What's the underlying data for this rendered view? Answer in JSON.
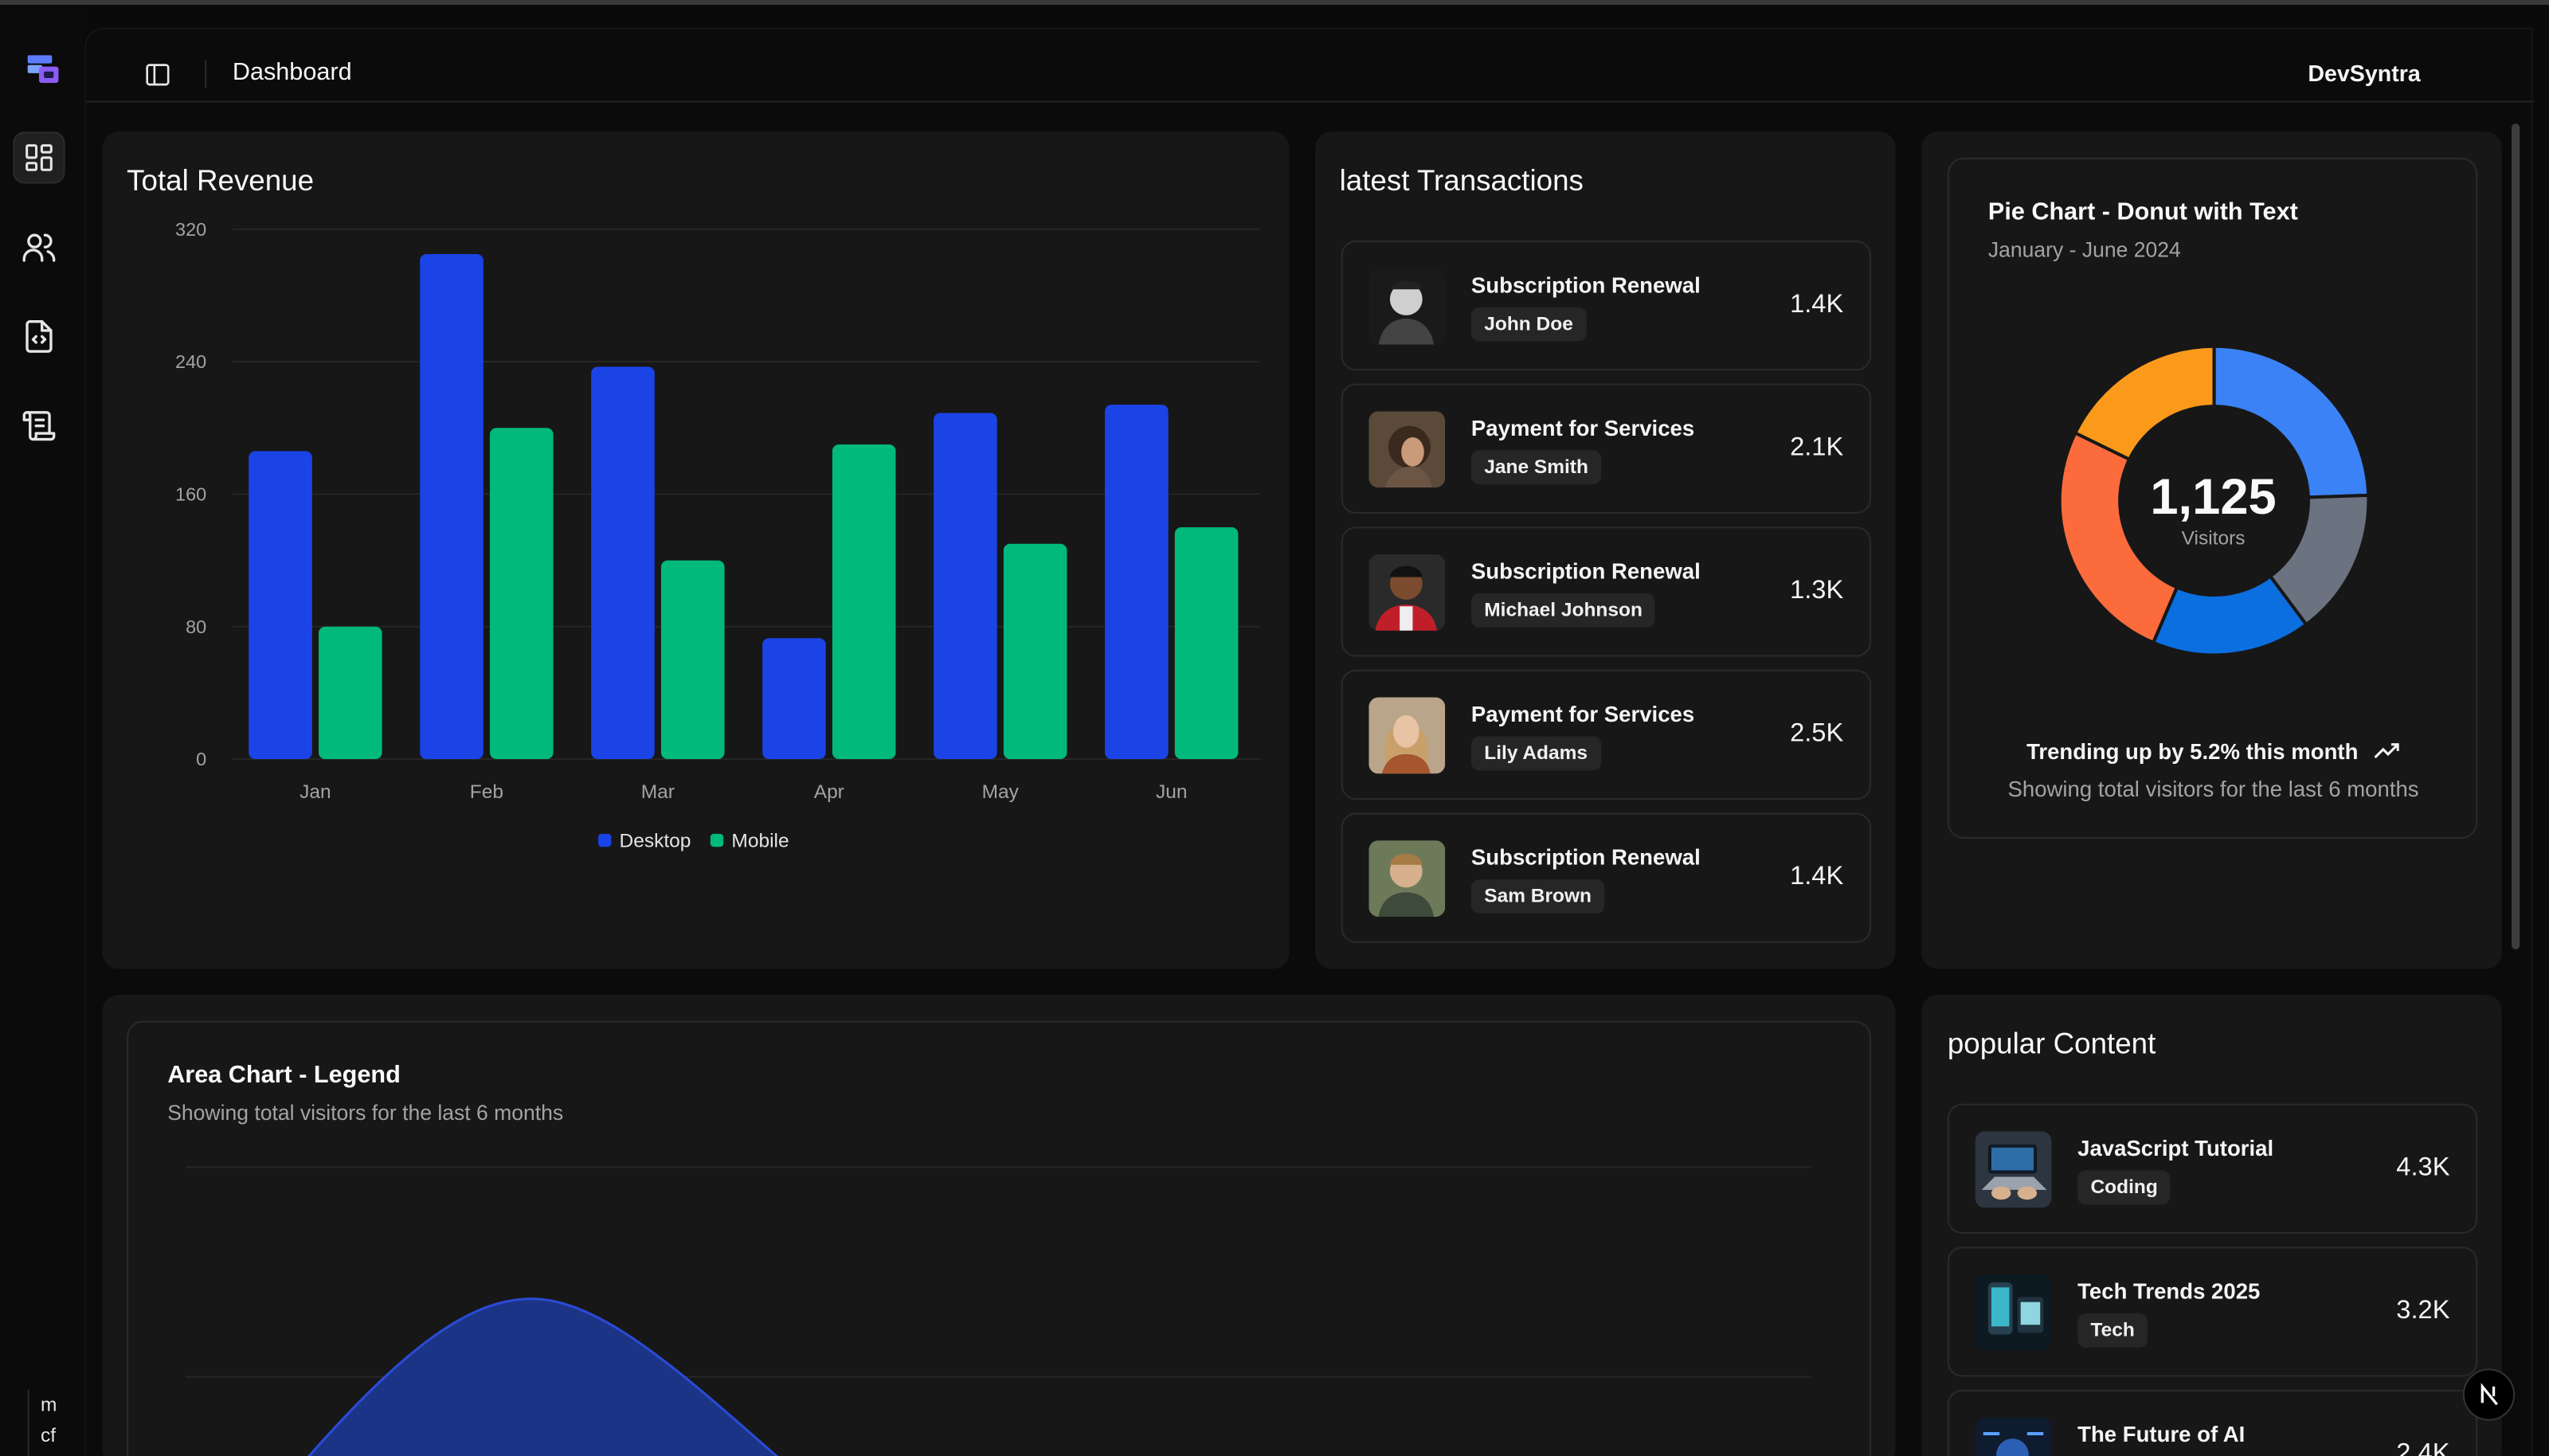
{
  "header": {
    "title": "Dashboard",
    "brand": "DevSyntra"
  },
  "sidebar": {
    "items": [
      {
        "icon": "dashboard-icon",
        "active": true
      },
      {
        "icon": "users-icon",
        "active": false
      },
      {
        "icon": "file-code-icon",
        "active": false
      },
      {
        "icon": "scroll-text-icon",
        "active": false
      }
    ],
    "user_text_1": "m",
    "user_text_2": "cf"
  },
  "revenue": {
    "title": "Total Revenue",
    "chart_data": {
      "type": "bar",
      "categories": [
        "Jan",
        "Feb",
        "Mar",
        "Apr",
        "May",
        "Jun"
      ],
      "series": [
        {
          "name": "Desktop",
          "color": "#1a44e6",
          "values": [
            186,
            305,
            237,
            73,
            209,
            214
          ]
        },
        {
          "name": "Mobile",
          "color": "#00b97a",
          "values": [
            80,
            200,
            120,
            190,
            130,
            140
          ]
        }
      ],
      "yticks": [
        "320",
        "240",
        "160",
        "80",
        "0"
      ],
      "ylim": [
        0,
        320
      ],
      "grid": true,
      "legend": "bottom-center"
    }
  },
  "transactions": {
    "title": "latest Transactions",
    "items": [
      {
        "title": "Subscription Renewal",
        "name": "John Doe",
        "amount": "1.4K",
        "thumb": "portrait-man-bw"
      },
      {
        "title": "Payment for Services",
        "name": "Jane Smith",
        "amount": "2.1K",
        "thumb": "portrait-woman-curly"
      },
      {
        "title": "Subscription Renewal",
        "name": "Michael Johnson",
        "amount": "1.3K",
        "thumb": "portrait-man-red-jacket"
      },
      {
        "title": "Payment for Services",
        "name": "Lily Adams",
        "amount": "2.5K",
        "thumb": "portrait-woman-blonde"
      },
      {
        "title": "Subscription Renewal",
        "name": "Sam Brown",
        "amount": "1.4K",
        "thumb": "portrait-man-outdoors"
      }
    ]
  },
  "pie": {
    "title": "Pie Chart - Donut with Text",
    "subtitle": "January - June 2024",
    "center_value": "1,125",
    "center_label": "Visitors",
    "trend_text": "Trending up by 5.2% this month",
    "footer": "Showing total visitors for the last 6 months",
    "chart_data": {
      "type": "pie",
      "donut": true,
      "slices": [
        {
          "color": "#3b82f6",
          "value": 275
        },
        {
          "color": "#6b7280",
          "value": 173
        },
        {
          "color": "#0b6fe0",
          "value": 187
        },
        {
          "color": "#fb6b3c",
          "value": 290
        },
        {
          "color": "#fb9a1a",
          "value": 200
        }
      ]
    }
  },
  "area": {
    "title": "Area Chart - Legend",
    "subtitle": "Showing total visitors for the last 6 months",
    "chart_data": {
      "type": "area",
      "series": [
        {
          "color": "#1e3db8"
        }
      ]
    }
  },
  "popular": {
    "title": "popular Content",
    "items": [
      {
        "title": "JavaScript Tutorial",
        "tag": "Coding",
        "amount": "4.3K",
        "thumb": "laptop-coding"
      },
      {
        "title": "Tech Trends 2025",
        "tag": "Tech",
        "amount": "3.2K",
        "thumb": "tech-phone"
      },
      {
        "title": "The Future of AI",
        "tag": "",
        "amount": "2.4K",
        "thumb": "ai-circuit"
      }
    ]
  }
}
